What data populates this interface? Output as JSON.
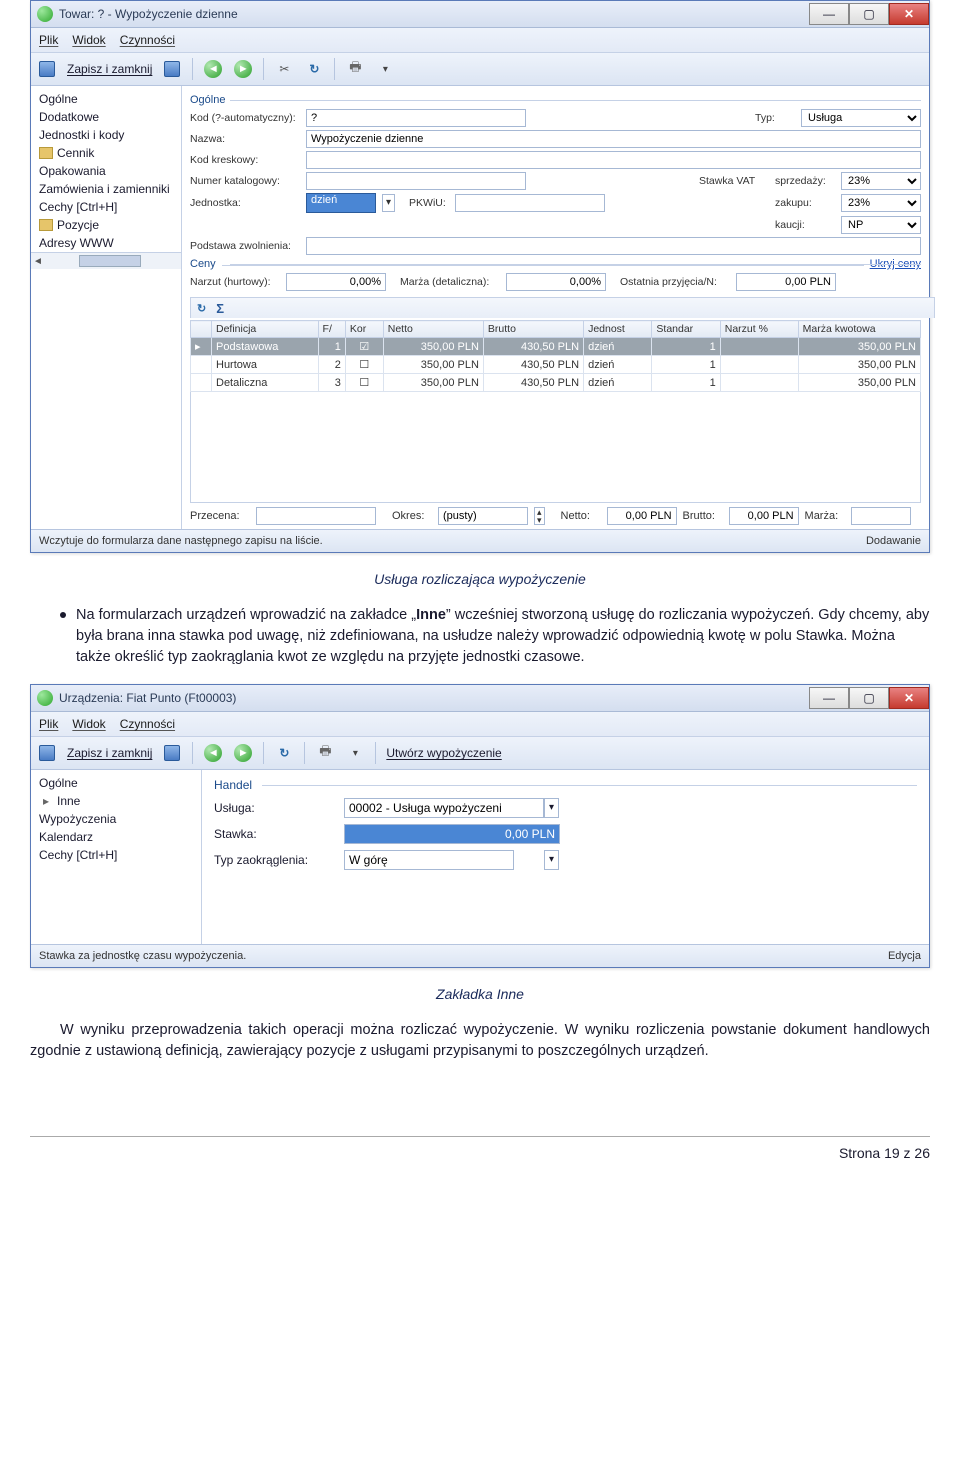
{
  "win1": {
    "title": "Towar: ? - Wypożyczenie dzienne",
    "menu": [
      "Plik",
      "Widok",
      "Czynności"
    ],
    "save_label": "Zapisz i zamknij",
    "side": [
      {
        "label": "Ogólne",
        "folder": false
      },
      {
        "label": "Dodatkowe",
        "folder": false
      },
      {
        "label": "Jednostki i kody",
        "folder": false
      },
      {
        "label": "Cennik",
        "folder": true
      },
      {
        "label": "Opakowania",
        "folder": false
      },
      {
        "label": "Zamówienia i zamienniki",
        "folder": false
      },
      {
        "label": "Cechy [Ctrl+H]",
        "folder": false
      },
      {
        "label": "Pozycje",
        "folder": true
      },
      {
        "label": "Adresy WWW",
        "folder": false
      }
    ],
    "group_ogolne": "Ogólne",
    "labels": {
      "kod": "Kod (?-automatyczny):",
      "typ": "Typ:",
      "nazwa": "Nazwa:",
      "kodkr": "Kod kreskowy:",
      "numkat": "Numer katalogowy:",
      "stawka": "Stawka VAT",
      "sprz": "sprzedaży:",
      "jed": "Jednostka:",
      "pkwiu": "PKWiU:",
      "zak": "zakupu:",
      "kauc": "kaucji:",
      "podst": "Podstawa zwolnienia:"
    },
    "vals": {
      "kod": "?",
      "typ": "Usługa",
      "nazwa": "Wypożyczenie dzienne",
      "jed": "dzień",
      "sprz": "23%",
      "zak": "23%",
      "kauc": "NP"
    },
    "group_ceny": "Ceny",
    "ukryj": "Ukryj ceny",
    "ceny_labels": {
      "narzut": "Narzut (hurtowy):",
      "marza": "Marża (detaliczna):",
      "ost": "Ostatnia przyjęcia/N:"
    },
    "ceny_vals": {
      "narzut": "0,00%",
      "marza": "0,00%",
      "ost": "0,00 PLN"
    },
    "table": {
      "headers": [
        "Definicja",
        "F/",
        "Kor",
        "Netto",
        "Brutto",
        "Jednost",
        "Standar",
        "Narzut %",
        "Marża kwotowa"
      ],
      "rows": [
        {
          "sel": true,
          "def": "Podstawowa",
          "f": "1",
          "kor": "☑",
          "netto": "350,00 PLN",
          "brutto": "430,50 PLN",
          "jed": "dzień",
          "std": "1",
          "narz": "",
          "mk": "350,00 PLN"
        },
        {
          "sel": false,
          "def": "Hurtowa",
          "f": "2",
          "kor": "☐",
          "netto": "350,00 PLN",
          "brutto": "430,50 PLN",
          "jed": "dzień",
          "std": "1",
          "narz": "",
          "mk": "350,00 PLN"
        },
        {
          "sel": false,
          "def": "Detaliczna",
          "f": "3",
          "kor": "☐",
          "netto": "350,00 PLN",
          "brutto": "430,50 PLN",
          "jed": "dzień",
          "std": "1",
          "narz": "",
          "mk": "350,00 PLN"
        }
      ]
    },
    "bottom": {
      "prz": "Przecena:",
      "okr": "Okres:",
      "okrval": "(pusty)",
      "netto": "Netto:",
      "nettov": "0,00 PLN",
      "brutto": "Brutto:",
      "bruttov": "0,00 PLN",
      "marza": "Marża:"
    },
    "status_l": "Wczytuje do formularza dane następnego zapisu na liście.",
    "status_r": "Dodawanie"
  },
  "caption1": "Usługa rozliczająca wypożyczenie",
  "bullet1_a": "Na formularzach urządzeń wprowadzić na zakładce „",
  "bullet1_b": "Inne",
  "bullet1_c": "” wcześniej stworzoną usługę do rozliczania wypożyczeń. Gdy chcemy, aby była brana inna stawka pod uwagę, niż zdefiniowana, na usłudze należy wprowadzić odpowiednią kwotę w polu Stawka. Można także określić typ zaokrąglania kwot ze względu na przyjęte jednostki czasowe.",
  "win2": {
    "title": "Urządzenia: Fiat Punto (Ft00003)",
    "menu": [
      "Plik",
      "Widok",
      "Czynności"
    ],
    "save_label": "Zapisz i zamknij",
    "tool_extra": "Utwórz wypożyczenie",
    "side": [
      "Ogólne",
      "Inne",
      "Wypożyczenia",
      "Kalendarz",
      "Cechy [Ctrl+H]"
    ],
    "side_sel": "Inne",
    "group": "Handel",
    "labels": {
      "usl": "Usługa:",
      "stw": "Stawka:",
      "typ": "Typ zaokrąglenia:"
    },
    "vals": {
      "usl": "00002 - Usługa wypożyczeni",
      "stw": "0,00 PLN",
      "typ": "W górę"
    },
    "status_l": "Stawka za jednostkę czasu wypożyczenia.",
    "status_r": "Edycja"
  },
  "caption2": "Zakładka Inne",
  "para2": "W wyniku przeprowadzenia takich operacji można rozliczać wypożyczenie. W wyniku rozliczenia powstanie dokument handlowych zgodnie z ustawioną definicją, zawierający pozycje z usługami przypisanymi to poszczególnych urządzeń.",
  "footer": "Strona 19 z 26"
}
